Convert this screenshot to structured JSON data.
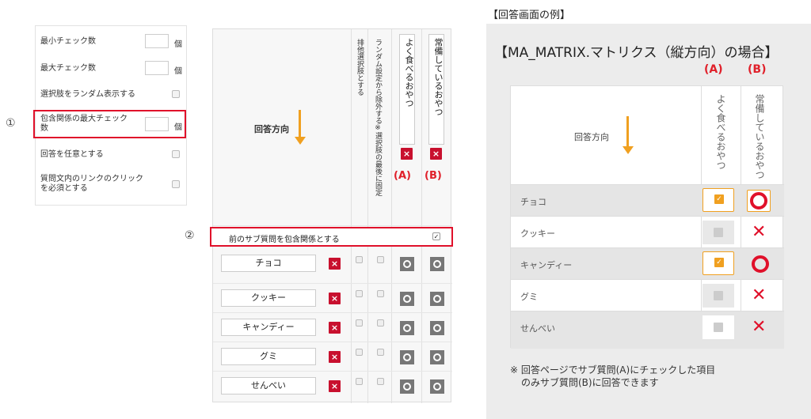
{
  "settings": {
    "rows": [
      {
        "label": "最小チェック数",
        "unit": "個"
      },
      {
        "label": "最大チェック数",
        "unit": "個"
      },
      {
        "label": "選択肢をランダム表示する"
      },
      {
        "label_line1": "包含関係の最大チェック",
        "label_line2": "数",
        "unit": "個"
      },
      {
        "label": "回答を任意とする"
      },
      {
        "label_line1": "質問文内のリンクのクリック",
        "label_line2": "を必須とする"
      }
    ],
    "marker": "①"
  },
  "matrix": {
    "direction_label": "回答方向",
    "col_exclusive": "排他選択肢とする",
    "col_random_exclude": "ランダム設定から除外する※選択肢の最後に固定",
    "sub_a": "よく食べるおやつ",
    "sub_b": "常備しているおやつ",
    "label_a": "(A)",
    "label_b": "(B)",
    "delete_symbol": "×",
    "inclusion_label": "前のサブ質問を包含関係とする",
    "inclusion_check": "✓",
    "marker": "②",
    "rows": [
      "チョコ",
      "クッキー",
      "キャンディー",
      "グミ",
      "せんべい"
    ]
  },
  "example": {
    "caption": "【回答画面の例】",
    "title": "【MA_MATRIX.マトリクス（縦方向）の場合】",
    "label_a": "(A)",
    "label_b": "(B)",
    "direction_label": "回答方向",
    "sub_a": "よく食べるおやつ",
    "sub_b": "常備しているおやつ",
    "rows": [
      "チョコ",
      "クッキー",
      "キャンディー",
      "グミ",
      "せんべい"
    ],
    "x_symbol": "✕",
    "note_line1": "※ 回答ページでサブ質問(A)にチェックした項目",
    "note_line2": "のみサブ質問(B)に回答できます"
  },
  "colors": {
    "accent_red": "#e0102a",
    "arrow_orange": "#f0a020",
    "delete_red": "#c8102e"
  }
}
